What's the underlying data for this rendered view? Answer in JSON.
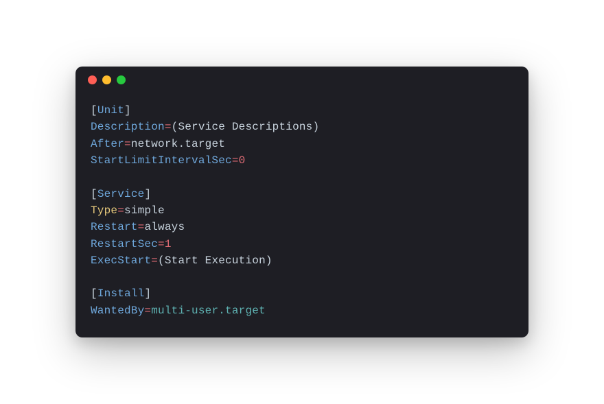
{
  "code": {
    "unit": {
      "section": "Unit",
      "description_key": "Description",
      "description_val": "Service Descriptions",
      "after_key": "After",
      "after_val": "network.target",
      "startlimit_key": "StartLimitIntervalSec",
      "startlimit_val": "0"
    },
    "service": {
      "section": "Service",
      "type_key": "Type",
      "type_val": "simple",
      "restart_key": "Restart",
      "restart_val": "always",
      "restartsec_key": "RestartSec",
      "restartsec_val": "1",
      "execstart_key": "ExecStart",
      "execstart_val": "Start Execution"
    },
    "install": {
      "section": "Install",
      "wantedby_key": "WantedBy",
      "wantedby_val": "multi-user.target"
    }
  },
  "symbols": {
    "eq": "=",
    "lbracket": "[",
    "rbracket": "]",
    "lparen": "(",
    "rparen": ")"
  }
}
